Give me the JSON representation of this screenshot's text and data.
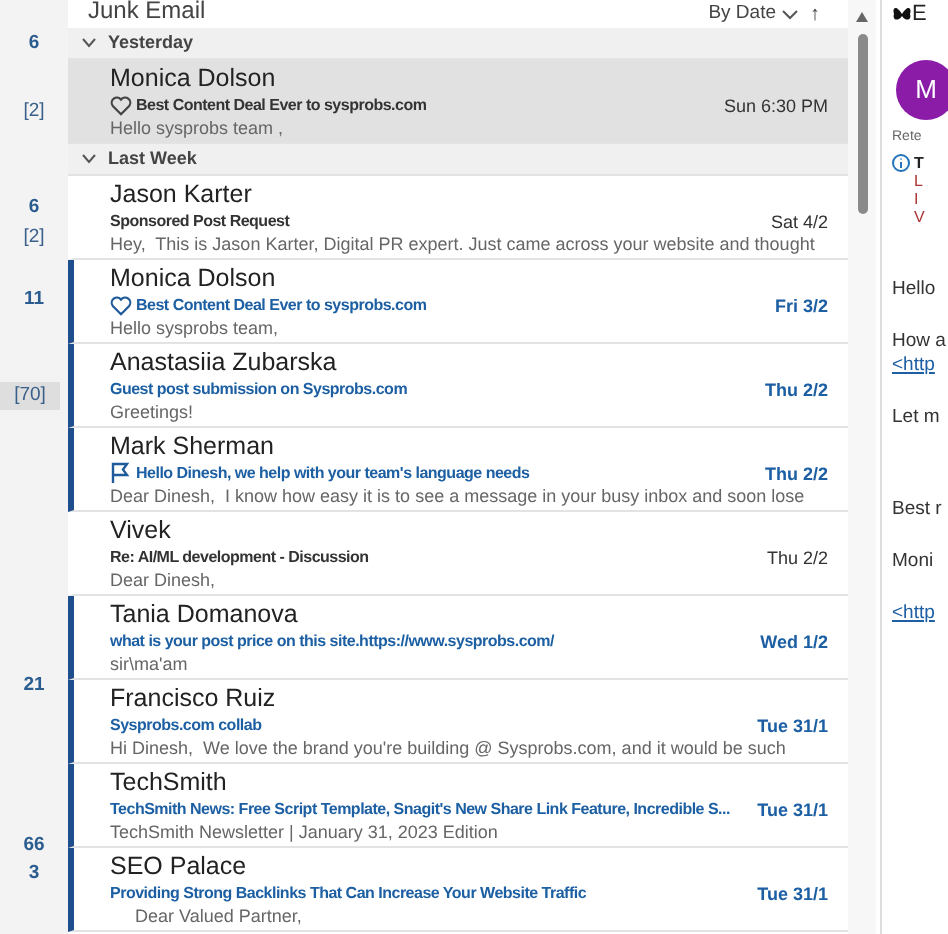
{
  "folder_counts": [
    {
      "text": "6",
      "selected": false
    },
    {
      "text": "[2]",
      "selected": false
    },
    {
      "text": "6",
      "selected": false
    },
    {
      "text": "[2]",
      "selected": false
    },
    {
      "text": "11",
      "selected": false
    },
    {
      "text": "[70]",
      "selected": true
    },
    {
      "text": "21",
      "selected": false
    },
    {
      "text": "66",
      "selected": false
    },
    {
      "text": "3",
      "selected": false
    }
  ],
  "list": {
    "title": "Junk Email",
    "sort": "By Date",
    "sort_direction_icon": "↑"
  },
  "groups": [
    {
      "label": "Yesterday",
      "expanded": true,
      "messages": [
        {
          "sender": "Monica Dolson",
          "subject": "Best Content Deal Ever to sysprobs.com",
          "preview": "Hello sysprobs team ,",
          "date": "Sun 6:30 PM",
          "unread": false,
          "selected": true,
          "kind": "liked"
        }
      ]
    },
    {
      "label": "Last Week",
      "expanded": true,
      "messages": [
        {
          "sender": "Jason Karter",
          "subject": "Sponsored Post Request",
          "preview": "Hey,  This is Jason Karter, Digital PR expert. Just came across your website and thought",
          "date": "Sat 4/2",
          "unread": false,
          "selected": false,
          "kind": "plain"
        },
        {
          "sender": "Monica Dolson",
          "subject": "Best Content Deal Ever to sysprobs.com",
          "preview": "Hello sysprobs team,",
          "date": "Fri 3/2",
          "unread": true,
          "selected": false,
          "kind": "liked"
        },
        {
          "sender": "Anastasiia Zubarska",
          "subject": "Guest post submission on Sysprobs.com",
          "preview": "Greetings!",
          "date": "Thu 2/2",
          "unread": true,
          "selected": false,
          "kind": "plain"
        },
        {
          "sender": "Mark Sherman",
          "subject": "Hello Dinesh, we help with your team's language needs",
          "preview": "Dear Dinesh,  I know how easy it is to see a message in your busy inbox and soon lose",
          "date": "Thu 2/2",
          "unread": true,
          "selected": false,
          "kind": "flagged"
        },
        {
          "sender": "Vivek",
          "subject": "Re: AI/ML development - Discussion",
          "preview": "Dear Dinesh,",
          "date": "Thu 2/2",
          "unread": false,
          "selected": false,
          "kind": "plain"
        },
        {
          "sender": "Tania Domanova",
          "subject": "what is your post price on this site.https://www.sysprobs.com/",
          "preview": "sir\\ma'am",
          "date": "Wed 1/2",
          "unread": true,
          "selected": false,
          "kind": "plain"
        },
        {
          "sender": "Francisco Ruiz",
          "subject": "Sysprobs.com collab",
          "preview": "Hi Dinesh,  We love the brand you're building @ Sysprobs.com, and it would be such",
          "date": "Tue 31/1",
          "unread": true,
          "selected": false,
          "kind": "plain"
        },
        {
          "sender": "TechSmith",
          "subject": "TechSmith News: Free Script Template, Snagit's New Share Link Feature, Incredible S...",
          "preview": "TechSmith Newsletter | January 31, 2023 Edition",
          "date": "Tue 31/1",
          "unread": true,
          "selected": false,
          "kind": "plain"
        },
        {
          "sender": "SEO Palace",
          "subject": "Providing Strong Backlinks That Can Increase Your Website Traffic",
          "preview": "     Dear Valued Partner,",
          "date": "Tue 31/1",
          "unread": true,
          "selected": false,
          "kind": "plain"
        }
      ]
    }
  ],
  "reading_pane": {
    "title": "E",
    "avatar": "M",
    "retention": "Rete",
    "info_title": "T",
    "info_lines": [
      "L",
      "I",
      "V"
    ],
    "body": [
      {
        "kind": "text",
        "text": "Hello"
      },
      {
        "kind": "text",
        "text": "How a"
      },
      {
        "kind": "link",
        "text": "<http"
      },
      {
        "kind": "text",
        "text": "Let m"
      },
      {
        "kind": "text",
        "text": "Best r"
      },
      {
        "kind": "text",
        "text": "Moni"
      },
      {
        "kind": "link",
        "text": "<http"
      }
    ]
  }
}
